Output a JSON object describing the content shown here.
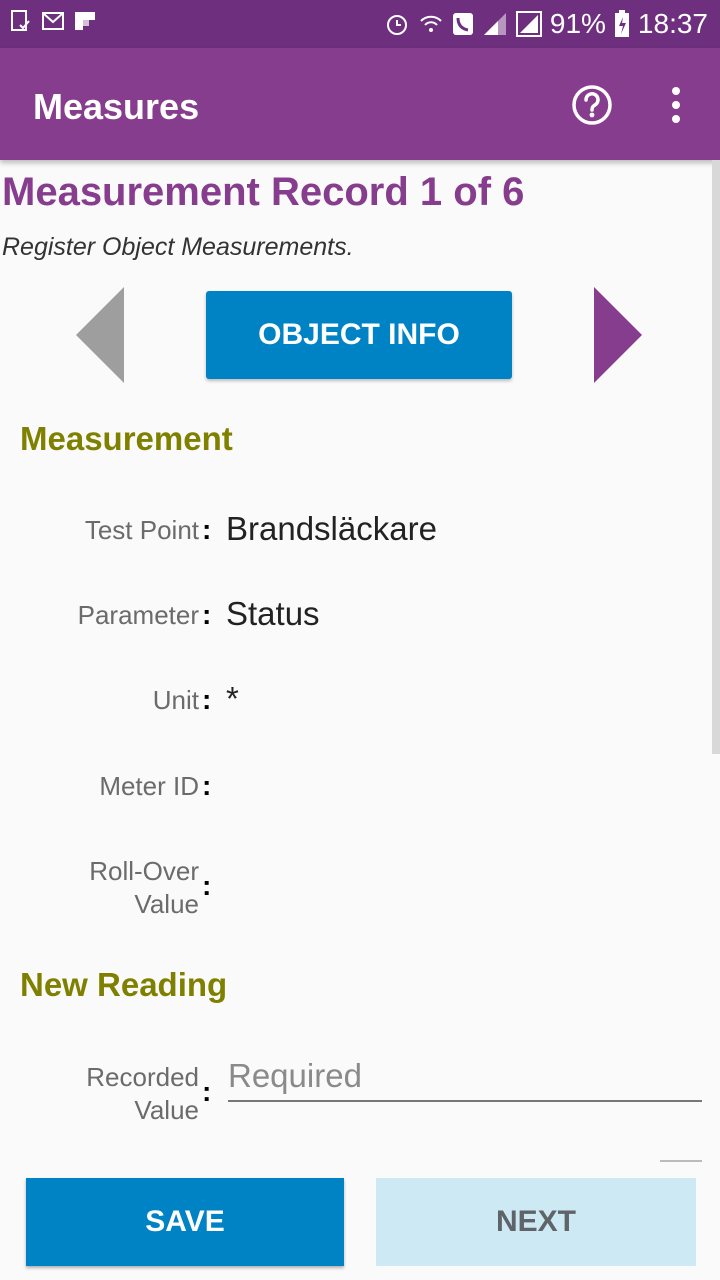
{
  "status_bar": {
    "battery": "91%",
    "time": "18:37",
    "icons": [
      "notification-doc-icon",
      "gmail-icon",
      "flipboard-icon",
      "alarm-icon",
      "wifi-call-icon",
      "phone-icon",
      "signal-icon",
      "signal-icon",
      "battery-charging-icon"
    ]
  },
  "appbar": {
    "title": "Measures",
    "help_icon": "help-icon",
    "menu_icon": "more-vert-icon",
    "color": "#873d8d"
  },
  "page": {
    "title": "Measurement Record 1 of 6",
    "subtitle": "Register Object Measurements.",
    "object_info_label": "OBJECT INFO"
  },
  "measurement": {
    "section_title": "Measurement",
    "rows": [
      {
        "label": "Test Point",
        "value": "Brandsläckare"
      },
      {
        "label": "Parameter",
        "value": "Status"
      },
      {
        "label": "Unit",
        "value": "*"
      },
      {
        "label": "Meter ID",
        "value": ""
      },
      {
        "label": "Roll-Over Value",
        "value": ""
      }
    ]
  },
  "new_reading": {
    "section_title": "New Reading",
    "recorded_value_label": "Recorded Value",
    "recorded_value": "",
    "recorded_value_placeholder": "Required"
  },
  "footer": {
    "save_label": "SAVE",
    "next_label": "NEXT"
  },
  "colors": {
    "primary": "#873d8d",
    "accent_blue": "#0083c4",
    "section_olive": "#808000"
  }
}
